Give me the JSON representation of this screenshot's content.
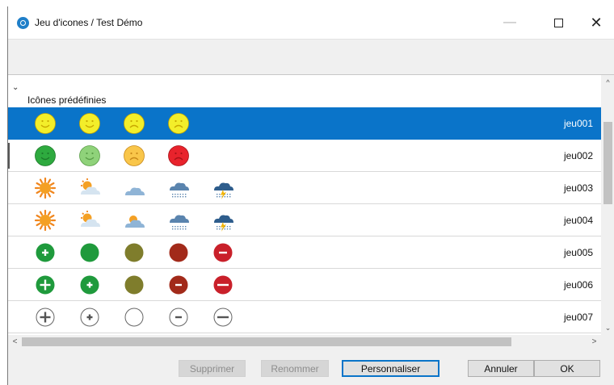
{
  "window": {
    "title": "Jeu d'icones / Test Démo"
  },
  "window_controls": {
    "minimize": "—",
    "close": "✕"
  },
  "group": {
    "label": "Icônes prédéfinies",
    "chevron": "⌄"
  },
  "rows": [
    {
      "code": "jeu001",
      "selected": true,
      "icons": [
        "smiley-yellow-happy",
        "smiley-yellow-happy",
        "smiley-yellow-sad",
        "smiley-yellow-sad"
      ]
    },
    {
      "code": "jeu002",
      "selected": false,
      "icons": [
        "smiley-green-happy",
        "smiley-lightgreen-happy",
        "smiley-orange-sad",
        "smiley-red-sad"
      ]
    },
    {
      "code": "jeu003",
      "selected": false,
      "icons": [
        "weather-sun",
        "weather-sun-cloud",
        "weather-cloud",
        "weather-rain",
        "weather-storm"
      ]
    },
    {
      "code": "jeu004",
      "selected": false,
      "icons": [
        "weather-sun",
        "weather-sun-cloud",
        "weather-sun-cloud-2",
        "weather-rain",
        "weather-storm"
      ]
    },
    {
      "code": "jeu005",
      "selected": false,
      "icons": [
        "plus-green-small",
        "dot-green",
        "dot-olive",
        "dot-darkred",
        "minus-red-small"
      ]
    },
    {
      "code": "jeu006",
      "selected": false,
      "icons": [
        "plus-green-large",
        "plus-green-small-2",
        "dot-olive",
        "minus-darkred",
        "minus-red-large"
      ]
    },
    {
      "code": "jeu007",
      "selected": false,
      "icons": [
        "plus-outline-large",
        "plus-outline-small",
        "circle-outline",
        "minus-outline-small",
        "minus-outline-large"
      ]
    }
  ],
  "scroll": {
    "up": "^",
    "down": "⌄",
    "left": "<",
    "right": ">"
  },
  "buttons": {
    "delete": "Supprimer",
    "rename": "Renommer",
    "customize": "Personnaliser",
    "cancel": "Annuler",
    "ok": "OK"
  },
  "colors": {
    "selection": "#0a74c9",
    "app_icon": "#1f7fc9"
  }
}
